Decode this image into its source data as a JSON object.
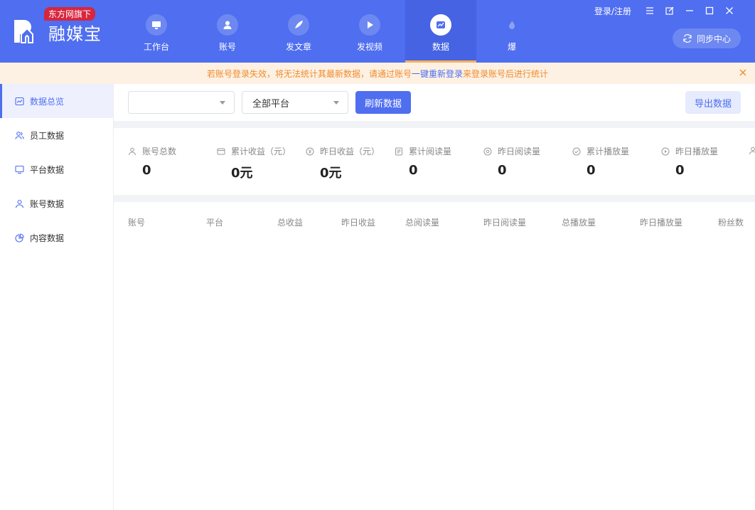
{
  "app": {
    "name": "融媒宝",
    "badge": "东方网旗下",
    "brand_color": "#4f6ef0",
    "accent_color": "#ffb05c"
  },
  "nav": {
    "items": [
      {
        "label": "工作台",
        "icon": "monitor-icon"
      },
      {
        "label": "账号",
        "icon": "user-icon"
      },
      {
        "label": "发文章",
        "icon": "feather-icon"
      },
      {
        "label": "发视频",
        "icon": "play-icon"
      },
      {
        "label": "数据",
        "icon": "chart-icon",
        "active": true
      },
      {
        "label": "爆",
        "icon": "flame-icon"
      }
    ]
  },
  "top_right": {
    "login": "登录/注册",
    "sync": "同步中心"
  },
  "notice": {
    "text_before": "若账号登录失效，将无法统计其最新数据，请通过账号 ",
    "link": "一键重新登录",
    "text_after": " 来登录账号后进行统计"
  },
  "sidebar": {
    "items": [
      {
        "label": "数据总览",
        "icon": "chart-line-icon",
        "active": true
      },
      {
        "label": "员工数据",
        "icon": "users-icon"
      },
      {
        "label": "平台数据",
        "icon": "monitor-icon"
      },
      {
        "label": "账号数据",
        "icon": "user-icon"
      },
      {
        "label": "内容数据",
        "icon": "pie-icon"
      }
    ]
  },
  "toolbar": {
    "select1_value": "",
    "select2_value": "全部平台",
    "refresh": "刷新数据",
    "export": "导出数据"
  },
  "stats": [
    {
      "label": "账号总数",
      "value": "0",
      "icon": "user-icon"
    },
    {
      "label": "累计收益（元）",
      "value": "0元",
      "icon": "wallet-icon"
    },
    {
      "label": "昨日收益（元）",
      "value": "0元",
      "icon": "coin-icon"
    },
    {
      "label": "累计阅读量",
      "value": "0",
      "icon": "doc-icon"
    },
    {
      "label": "昨日阅读量",
      "value": "0",
      "icon": "eye-icon"
    },
    {
      "label": "累计播放量",
      "value": "0",
      "icon": "check-circle-icon"
    },
    {
      "label": "昨日播放量",
      "value": "0",
      "icon": "play-circle-icon"
    }
  ],
  "table": {
    "headers": [
      "账号",
      "平台",
      "总收益",
      "昨日收益",
      "总阅读量",
      "昨日阅读量",
      "总播放量",
      "昨日播放量",
      "粉丝数"
    ]
  }
}
